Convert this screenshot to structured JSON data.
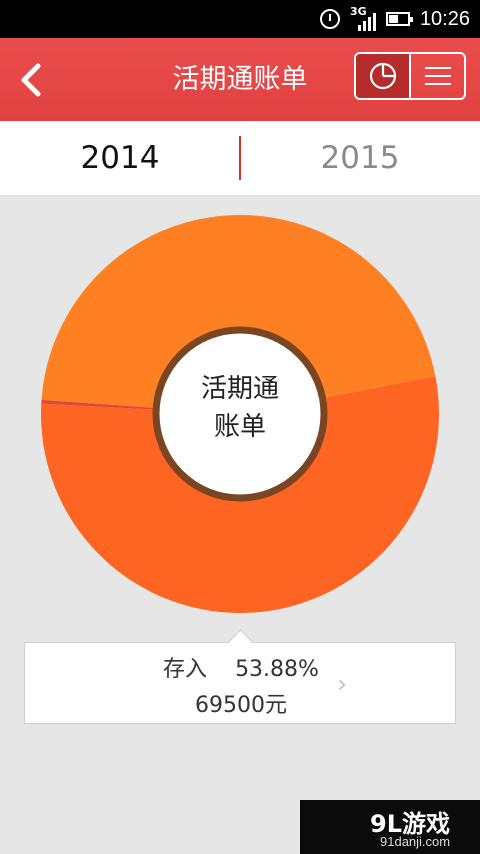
{
  "status_bar": {
    "network": "3G",
    "time": "10:26"
  },
  "header": {
    "title": "活期通账单"
  },
  "year_tabs": [
    {
      "label": "2014",
      "selected": true
    },
    {
      "label": "2015",
      "selected": false
    }
  ],
  "colors": {
    "header_red": "#e14040",
    "slice_deposit": "#fe6422",
    "slice_other": "#ff8022",
    "slice_thin": "#e0463a",
    "ring_border": "#7a4522"
  },
  "chart_data": {
    "type": "pie",
    "center_label": [
      "活期通",
      "账单"
    ],
    "slices": [
      {
        "name": "存入",
        "percent": 53.88
      },
      {
        "name": "",
        "percent": 45.82
      },
      {
        "name": "",
        "percent": 0.3
      }
    ]
  },
  "info": {
    "label": "存入",
    "percent": "53.88%",
    "amount": "69500元"
  },
  "watermark": {
    "logo": "9L游戏",
    "url": "91danji.com"
  }
}
